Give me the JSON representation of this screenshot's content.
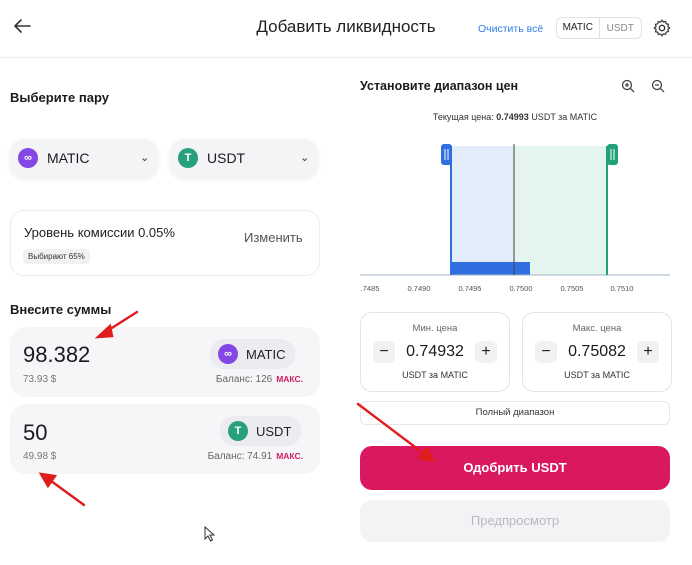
{
  "header": {
    "title": "Добавить ликвидность",
    "clear_all": "Очистить всё",
    "toggle": [
      "MATIC",
      "USDT"
    ]
  },
  "pair": {
    "label": "Выберите пару",
    "token_a": "MATIC",
    "token_b": "USDT"
  },
  "fee": {
    "text": "Уровень комиссии 0.05%",
    "badge": "Выбирают 65%",
    "change": "Изменить"
  },
  "amounts": {
    "label": "Внесите суммы",
    "a": {
      "value": "98.382",
      "usd": "73.93 $",
      "token": "MATIC",
      "balance": "Баланс: 126",
      "max": "МАКС."
    },
    "b": {
      "value": "50",
      "usd": "49.98 $",
      "token": "USDT",
      "balance": "Баланс: 74.91",
      "max": "МАКС."
    }
  },
  "range": {
    "title": "Установите диапазон цен",
    "current_label": "Текущая цена:",
    "current_value": "0.74993",
    "current_unit": "USDT за MATIC",
    "ticks": [
      ".7485",
      "0.7490",
      "0.7495",
      "0.7500",
      "0.7505",
      "0.7510"
    ],
    "min": {
      "title": "Мин. цена",
      "value": "0.74932",
      "unit": "USDT за MATIC"
    },
    "max": {
      "title": "Макс. цена",
      "value": "0.75082",
      "unit": "USDT за MATIC"
    },
    "full_range": "Полный диапазон"
  },
  "actions": {
    "approve": "Одобрить USDT",
    "preview": "Предпросмотр"
  },
  "colors": {
    "accent": "#d9185f",
    "matic": "#8247e5",
    "usdt": "#26a17b",
    "range_left": "#2f6fe0",
    "range_right": "#1fa27a"
  }
}
